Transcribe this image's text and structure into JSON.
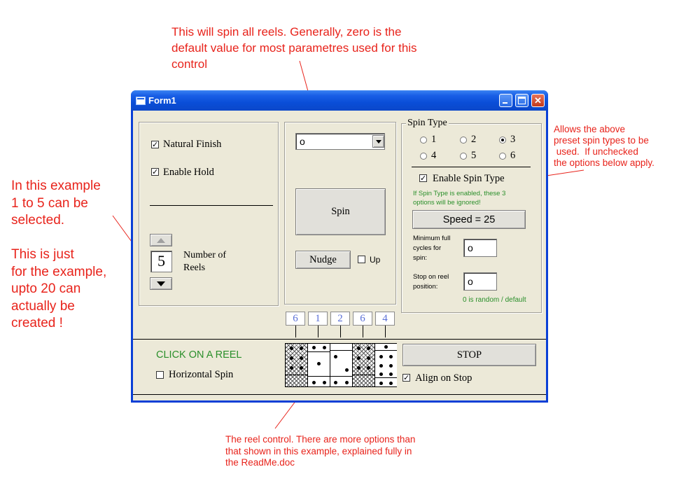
{
  "annotations": {
    "top": [
      "This will spin all reels.  Generally, zero is the",
      "default value for most parametres used for this",
      "control"
    ],
    "left": [
      "In this example",
      "1 to 5 can be",
      "selected.",
      "",
      "This is just",
      "for the example,",
      "upto 20 can",
      "actually be",
      "created !"
    ],
    "right": [
      "Allows the above",
      "preset spin types to be",
      " used.  If unchecked",
      "the options below apply."
    ],
    "bottom": [
      "The reel control. There are more options than",
      "that shown in this example, explained fully in",
      "the ReadMe.doc"
    ]
  },
  "window": {
    "title": "Form1"
  },
  "left_panel": {
    "natural_finish": {
      "label": "Natural Finish",
      "checked": true
    },
    "enable_hold": {
      "label": "Enable Hold",
      "checked": true
    },
    "reels_count": "5",
    "reels_label_1": "Number of",
    "reels_label_2": "Reels"
  },
  "center_panel": {
    "combo_value": "o",
    "spin_label": "Spin",
    "nudge_label": "Nudge",
    "up_label": "Up",
    "up_checked": false
  },
  "spin_type": {
    "legend": "Spin Type",
    "options": [
      "1",
      "2",
      "3",
      "4",
      "5",
      "6"
    ],
    "selected": "3",
    "enable_label": "Enable Spin Type",
    "enable_checked": true,
    "note_1": "If Spin Type is enabled, these 3",
    "note_2": "options will be ignored!",
    "speed_label": "Speed = 25",
    "min_cycles_1": "Minimum full",
    "min_cycles_2": "cycles for",
    "min_cycles_3": "spin:",
    "min_cycles_value": "o",
    "stop_pos_1": "Stop on reel",
    "stop_pos_2": "position:",
    "stop_pos_value": "o",
    "random_note": "0 is random / default"
  },
  "reel_numbers": [
    "6",
    "1",
    "2",
    "6",
    "4"
  ],
  "bottom": {
    "click_label": "CLICK ON A REEL",
    "horizontal_label": "Horizontal Spin",
    "horizontal_checked": false,
    "stop_label": "STOP",
    "align_label": "Align on Stop",
    "align_checked": true
  },
  "colors": {
    "annotation": "#e8231b",
    "green_text": "#2a8f2a",
    "reel_number": "#5a6fd6",
    "window_face": "#ece9d8",
    "titlebar": "#0a4ed8"
  }
}
